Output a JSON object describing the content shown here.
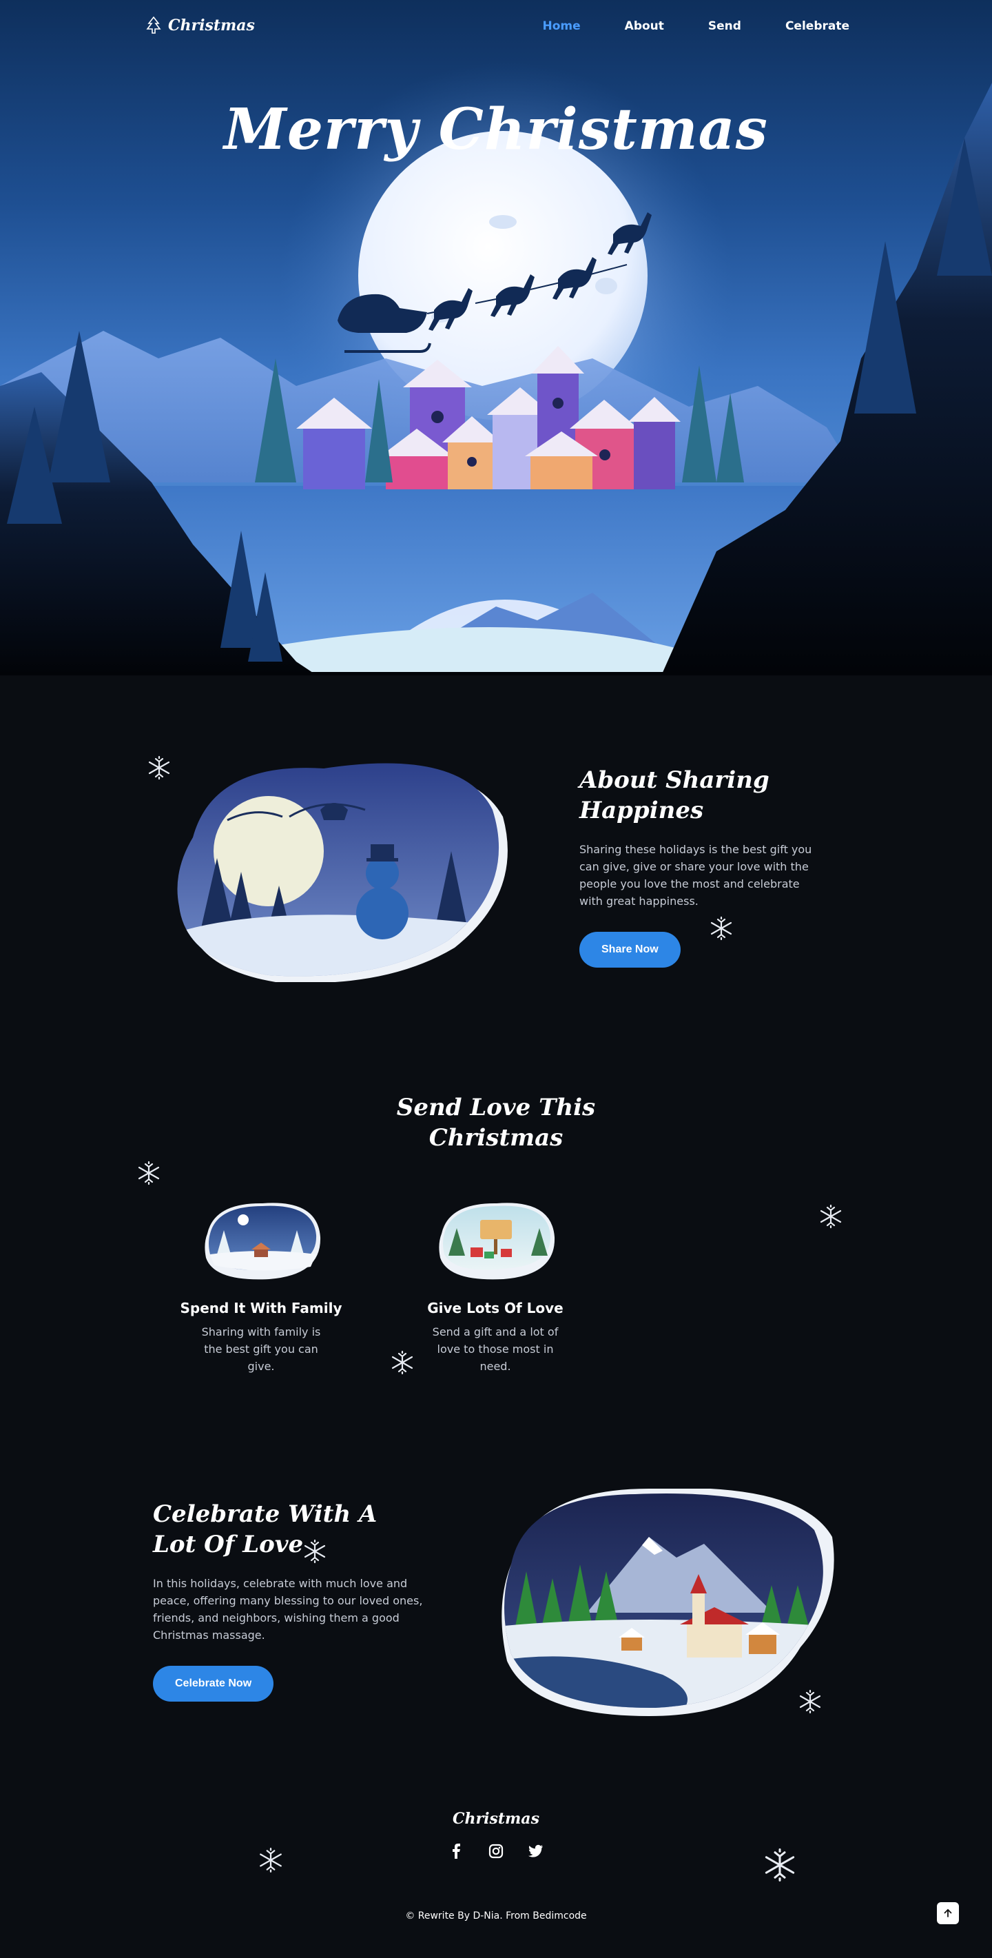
{
  "header": {
    "logo_text": "Christmas",
    "nav": [
      {
        "label": "Home",
        "active": true
      },
      {
        "label": "About",
        "active": false
      },
      {
        "label": "Send",
        "active": false
      },
      {
        "label": "Celebrate",
        "active": false
      }
    ]
  },
  "hero": {
    "title": "Merry Christmas"
  },
  "about": {
    "title_line1": "About Sharing",
    "title_line2": "Happines",
    "description": "Sharing these holidays is the best gift you can give, give or share your love with the people you love the most and celebrate with great happiness.",
    "button": "Share Now"
  },
  "send": {
    "title_line1": "Send Love This",
    "title_line2": "Christmas",
    "cards": [
      {
        "title": "Spend It With Family",
        "description": "Sharing with family is the best gift you can give."
      },
      {
        "title": "Give Lots Of Love",
        "description": "Send a gift and a lot of love to those most in need."
      }
    ]
  },
  "celebrate": {
    "title_line1": "Celebrate With A",
    "title_line2": "Lot Of Love",
    "description": "In this holidays, celebrate with much love and peace, offering many blessing to our loved ones, friends, and neighbors, wishing them a good Christmas massage.",
    "button": "Celebrate Now"
  },
  "footer": {
    "logo_text": "Christmas",
    "social": [
      "facebook-icon",
      "instagram-icon",
      "twitter-icon"
    ],
    "copyright": "© Rewrite By D-Nia. From Bedimcode"
  },
  "colors": {
    "accent": "#2d86e6",
    "nav_active": "#4a9cff",
    "background": "#0a0d12"
  }
}
